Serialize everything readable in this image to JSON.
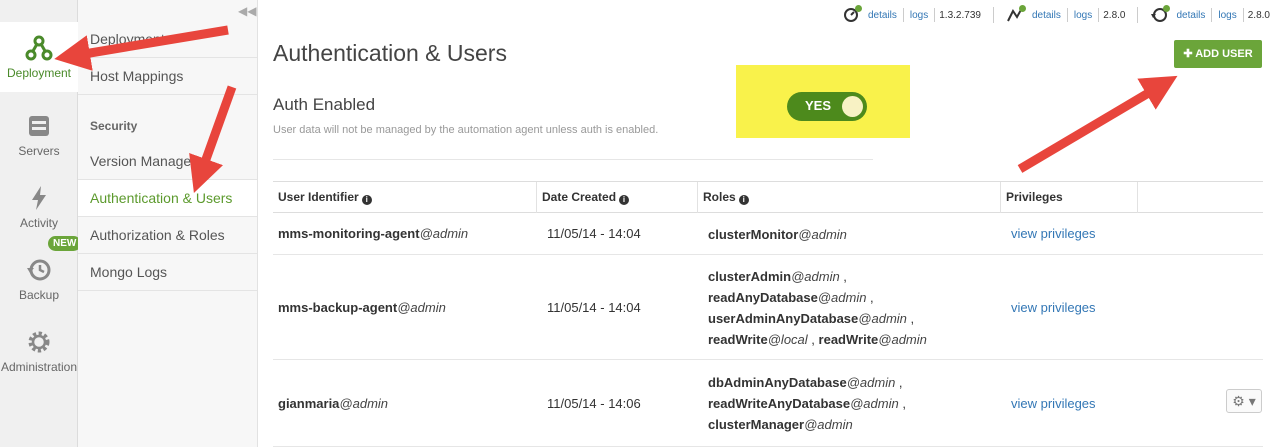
{
  "rail": [
    {
      "label": "Deployment",
      "icon": "deployment-icon"
    },
    {
      "label": "Servers",
      "icon": "server-icon"
    },
    {
      "label": "Activity",
      "icon": "lightning-icon"
    },
    {
      "label": "Backup",
      "icon": "history-icon"
    },
    {
      "label": "Administration",
      "icon": "gear-icon"
    }
  ],
  "new_badge": "NEW",
  "subnav": {
    "items": [
      "Deployment",
      "Host Mappings"
    ],
    "security_heading": "Security",
    "security_items": [
      "Version Manager",
      "Authentication & Users",
      "Authorization & Roles",
      "Mongo Logs"
    ]
  },
  "topbar": {
    "agents": [
      {
        "details": "details",
        "logs": "logs",
        "version": "1.3.2.739"
      },
      {
        "details": "details",
        "logs": "logs",
        "version": "2.8.0"
      },
      {
        "details": "details",
        "logs": "logs",
        "version": "2.8.0"
      }
    ]
  },
  "page": {
    "title": "Authentication & Users",
    "add_user": "✚ ADD USER",
    "auth_label": "Auth Enabled",
    "auth_hint": "User data will not be managed by the automation agent unless auth is enabled.",
    "toggle_label": "YES"
  },
  "table": {
    "headers": [
      "User Identifier",
      "Date Created",
      "Roles",
      "Privileges"
    ],
    "rows": [
      {
        "user": "mms-monitoring-agent",
        "db": "@admin",
        "date": "11/05/14 - 14:04",
        "roles": [
          [
            [
              "clusterMonitor",
              "@admin",
              ""
            ]
          ]
        ],
        "privileges": "view privileges"
      },
      {
        "user": "mms-backup-agent",
        "db": "@admin",
        "date": "11/05/14 - 14:04",
        "roles": [
          [
            [
              "clusterAdmin",
              "@admin",
              " ,"
            ]
          ],
          [
            [
              "readAnyDatabase",
              "@admin",
              " ,"
            ]
          ],
          [
            [
              "userAdminAnyDatabase",
              "@admin",
              " ,"
            ]
          ],
          [
            [
              "readWrite",
              "@local",
              " ,"
            ],
            [
              "readWrite",
              "@admin",
              ""
            ]
          ]
        ],
        "privileges": "view privileges"
      },
      {
        "user": "gianmaria",
        "db": "@admin",
        "date": "11/05/14 - 14:06",
        "roles": [
          [
            [
              "dbAdminAnyDatabase",
              "@admin",
              " ,"
            ]
          ],
          [
            [
              "readWriteAnyDatabase",
              "@admin",
              " ,"
            ]
          ],
          [
            [
              "clusterManager",
              "@admin",
              ""
            ]
          ]
        ],
        "privileges": "view privileges"
      }
    ]
  },
  "colors": {
    "accent": "#6ba53a",
    "link": "#3377b5",
    "highlight": "#f9f24b",
    "arrow": "#e8453c"
  }
}
